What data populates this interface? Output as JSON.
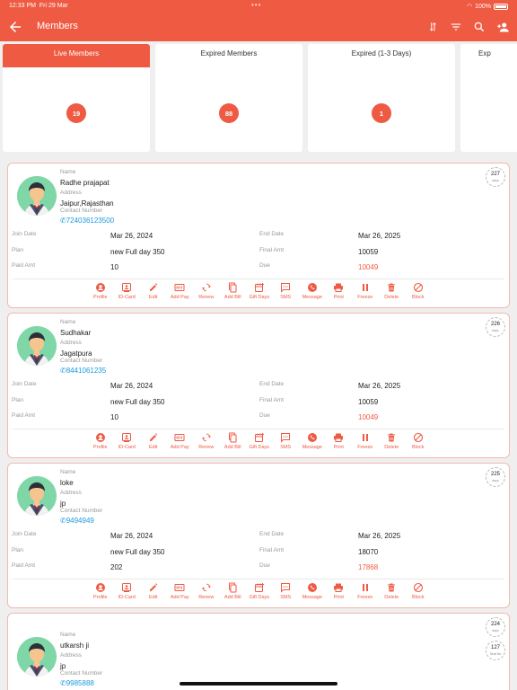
{
  "status": {
    "time": "12:33 PM",
    "date": "Fri 29 Mar",
    "battery": "100%"
  },
  "header": {
    "title": "Members"
  },
  "tabs": [
    {
      "label": "Live Members",
      "count": "19",
      "active": true
    },
    {
      "label": "Expired Members",
      "count": "88",
      "active": false
    },
    {
      "label": "Expired (1-3 Days)",
      "count": "1",
      "active": false
    },
    {
      "label": "Exp",
      "count": "",
      "active": false
    }
  ],
  "labels": {
    "name": "Name",
    "address": "Address",
    "contact": "Contact Number",
    "join": "Join Date",
    "end": "End Date",
    "plan": "Plan",
    "final": "Final Amt",
    "paid": "Paid Amt",
    "due": "Due",
    "days_unit": "days",
    "seat": "Seat No"
  },
  "actions": [
    "Profile",
    "ID-Card",
    "Edit",
    "Add Pay",
    "Renew",
    "Add Bill",
    "Gift Days",
    "SMS",
    "Message",
    "Print",
    "Freeze",
    "Delete",
    "Block"
  ],
  "members": [
    {
      "name": "Radhe prajapat",
      "address": "Jaipur,Rajasthan",
      "phone": "7240361235​00",
      "days": "227",
      "join": "Mar 26, 2024",
      "end": "Mar 26, 2025",
      "plan": "new Full day 350",
      "final": "10059",
      "paid": "10",
      "due": "10049"
    },
    {
      "name": "Sudhakar",
      "address": "Jagatpura",
      "phone": "8441061235",
      "days": "226",
      "join": "Mar 26, 2024",
      "end": "Mar 26, 2025",
      "plan": "new Full day 350",
      "final": "10059",
      "paid": "10",
      "due": "10049"
    },
    {
      "name": "loke",
      "address": "jp",
      "phone": "9494949",
      "days": "225",
      "join": "Mar 26, 2024",
      "end": "Mar 26, 2025",
      "plan": "new Full day 350",
      "final": "18070",
      "paid": "202",
      "due": "17868"
    },
    {
      "name": "utkarsh ji",
      "address": "jp",
      "phone": "9985888",
      "days": "224",
      "seat": "127"
    }
  ],
  "colors": {
    "accent": "#ef5a43",
    "phone": "#1a9adf",
    "avatar_bg": "#7fd6a6"
  }
}
